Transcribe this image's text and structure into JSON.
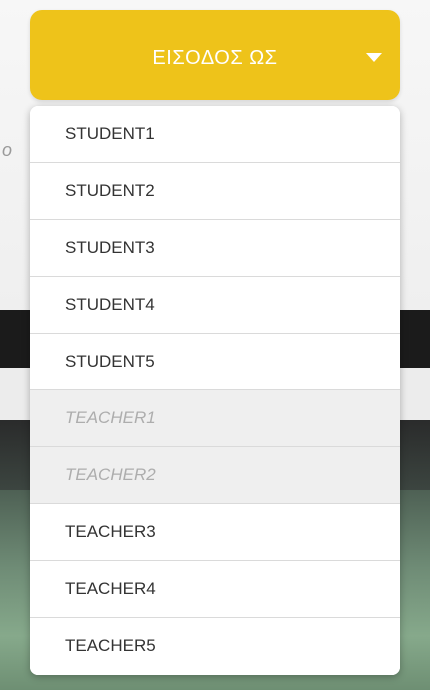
{
  "dropdown": {
    "title": "ΕΙΣΟΔΟΣ ΩΣ",
    "icon": "caret-down-icon",
    "accent_color": "#eec31a",
    "items": [
      {
        "label": "STUDENT1",
        "disabled": false
      },
      {
        "label": "STUDENT2",
        "disabled": false
      },
      {
        "label": "STUDENT3",
        "disabled": false
      },
      {
        "label": "STUDENT4",
        "disabled": false
      },
      {
        "label": "STUDENT5",
        "disabled": false
      },
      {
        "label": "TEACHER1",
        "disabled": true
      },
      {
        "label": "TEACHER2",
        "disabled": true
      },
      {
        "label": "TEACHER3",
        "disabled": false
      },
      {
        "label": "TEACHER4",
        "disabled": false
      },
      {
        "label": "TEACHER5",
        "disabled": false
      }
    ]
  },
  "background": {
    "fragment_text": "o"
  }
}
